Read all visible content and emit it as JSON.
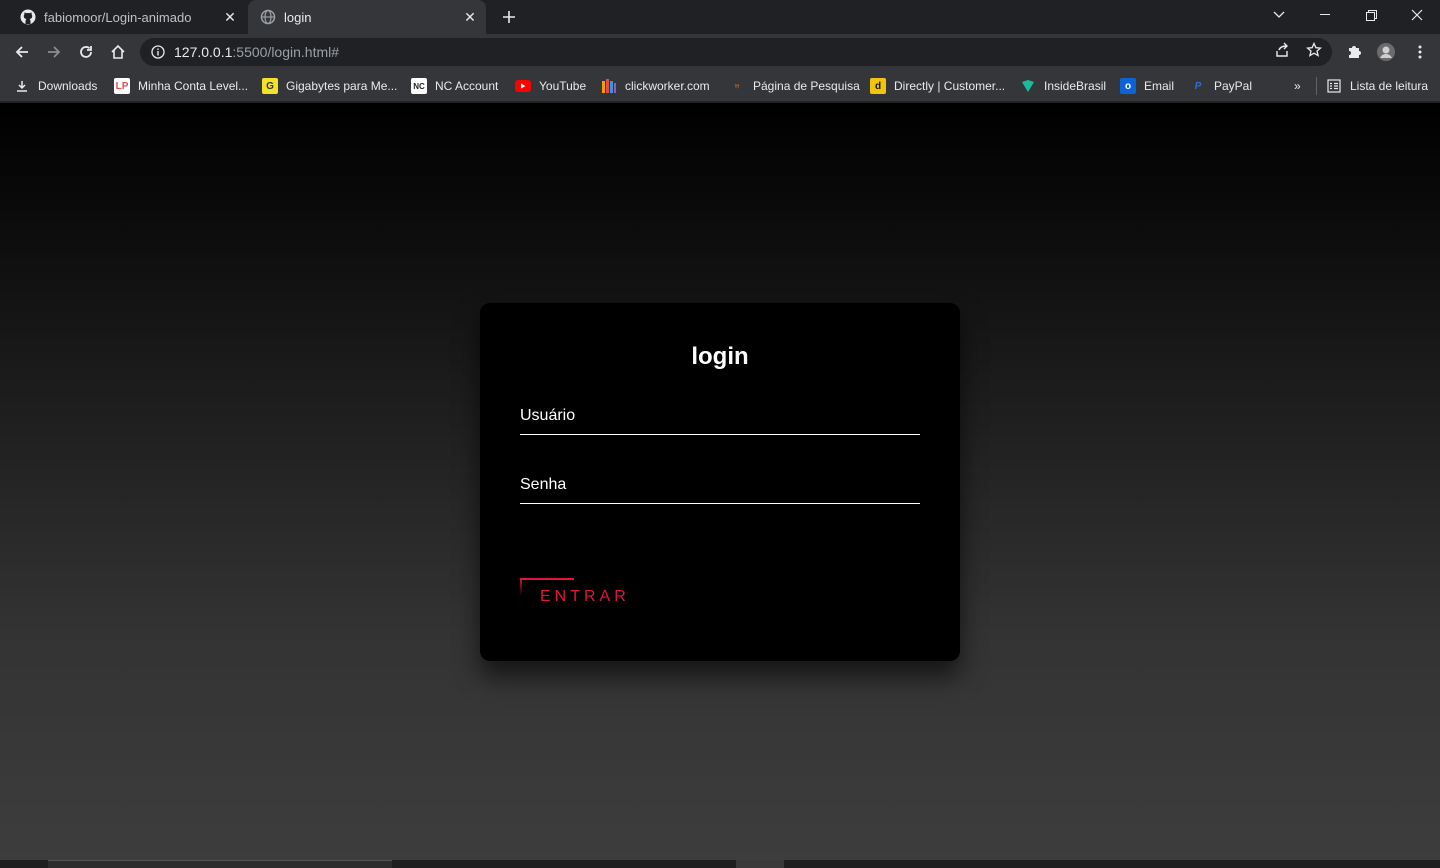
{
  "browser": {
    "tabs": [
      {
        "title": "fabiomoor/Login-animado",
        "icon": "github-icon",
        "active": false
      },
      {
        "title": "login",
        "icon": "globe-icon",
        "active": true
      }
    ],
    "address": {
      "host": "127.0.0.1",
      "rest": ":5500/login.html#"
    },
    "bookmarks": [
      {
        "label": "Downloads",
        "icon": "download-icon"
      },
      {
        "label": "Minha Conta Level...",
        "icon": "level-icon"
      },
      {
        "label": "Gigabytes para Me...",
        "icon": "gigabytes-icon"
      },
      {
        "label": "NC Account",
        "icon": "nc-icon"
      },
      {
        "label": "YouTube",
        "icon": "youtube-icon"
      },
      {
        "label": "clickworker.com",
        "icon": "clickworker-icon"
      },
      {
        "label": "Página de Pesquisa",
        "icon": "pesquisa-icon"
      },
      {
        "label": "Directly | Customer...",
        "icon": "directly-icon"
      },
      {
        "label": "InsideBrasil",
        "icon": "insidebrasil-icon"
      },
      {
        "label": "Email",
        "icon": "outlook-icon"
      },
      {
        "label": "PayPal",
        "icon": "paypal-icon"
      }
    ],
    "more_bookmarks": "»",
    "reading_list": "Lista de leitura"
  },
  "login": {
    "title": "login",
    "username_label": "Usuário",
    "password_label": "Senha",
    "submit_label": "ENTRAR"
  },
  "colors": {
    "accent": "#e0143c",
    "box_background": "#000000"
  }
}
